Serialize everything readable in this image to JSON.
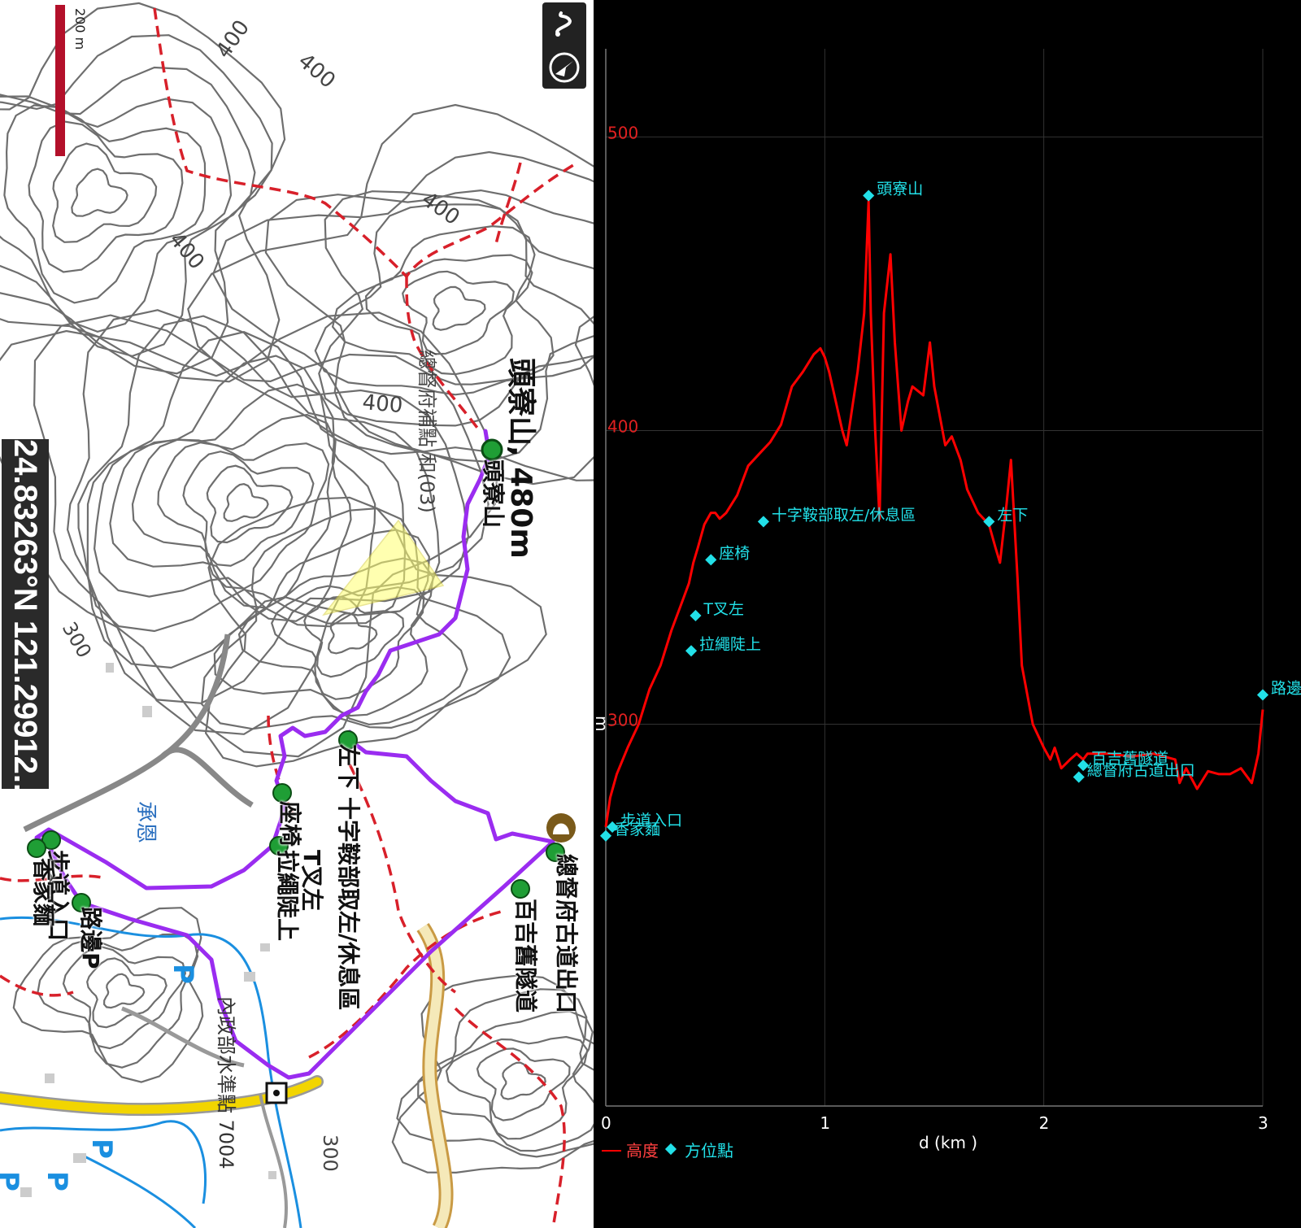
{
  "map": {
    "scale_label": "200 m",
    "coordinates": "24.83263°N 121.29912...",
    "summit_label": "頭寮山, 480m",
    "benchmark_label": "總督府補點 和(03)",
    "river_label": "承恩",
    "level_point_label": "內政部水準點 7004",
    "contour_labels": [
      "400",
      "400",
      "400",
      "400",
      "400",
      "300",
      "300"
    ],
    "waypoint_labels": [
      {
        "label": "頭寮山"
      },
      {
        "label": "左下"
      },
      {
        "label": "十字鞍部取左/休息區"
      },
      {
        "label": "座椅"
      },
      {
        "label": "T叉左"
      },
      {
        "label": "拉繩陡上"
      },
      {
        "label": "步道入口"
      },
      {
        "label": "香家麵"
      },
      {
        "label": "路邊P"
      },
      {
        "label": "總督府古道出口"
      },
      {
        "label": "百吉舊隧道"
      }
    ],
    "parking_labels": [
      "P",
      "P",
      "P",
      "P"
    ],
    "colors": {
      "track": "#9a2cf0",
      "trail": "#d8202a",
      "road": "#f2d500",
      "water": "#1a8fe0",
      "contour": "#555555"
    },
    "icons": {
      "scale": "scale-bar",
      "route": "route-icon",
      "compass": "compass-icon"
    }
  },
  "chart_data": {
    "type": "line",
    "title": "",
    "xlabel": "d (km )",
    "ylabel": "m",
    "xlim": [
      0,
      3.0
    ],
    "ylim": [
      170,
      530
    ],
    "x_ticks": [
      0,
      1,
      2,
      3
    ],
    "y_ticks": [
      300,
      400,
      500
    ],
    "grid": true,
    "legend_placement": "bottom-left",
    "series": [
      {
        "name": "高度",
        "color": "#ff0000",
        "x": [
          0.0,
          0.02,
          0.05,
          0.1,
          0.15,
          0.2,
          0.25,
          0.3,
          0.35,
          0.38,
          0.4,
          0.42,
          0.45,
          0.48,
          0.5,
          0.52,
          0.55,
          0.6,
          0.65,
          0.7,
          0.75,
          0.8,
          0.85,
          0.9,
          0.95,
          0.98,
          1.0,
          1.02,
          1.05,
          1.08,
          1.1,
          1.13,
          1.15,
          1.18,
          1.2,
          1.21,
          1.23,
          1.25,
          1.27,
          1.3,
          1.32,
          1.35,
          1.38,
          1.4,
          1.45,
          1.48,
          1.5,
          1.55,
          1.58,
          1.62,
          1.65,
          1.7,
          1.75,
          1.78,
          1.8,
          1.83,
          1.85,
          1.88,
          1.9,
          1.95,
          2.0,
          2.03,
          2.05,
          2.08,
          2.12,
          2.15,
          2.18,
          2.2,
          2.3,
          2.4,
          2.5,
          2.6,
          2.62,
          2.65,
          2.7,
          2.75,
          2.8,
          2.85,
          2.9,
          2.95,
          2.98,
          3.0
        ],
        "y": [
          265,
          275,
          283,
          292,
          300,
          312,
          320,
          332,
          342,
          348,
          355,
          360,
          368,
          372,
          372,
          370,
          372,
          378,
          388,
          392,
          396,
          402,
          415,
          420,
          426,
          428,
          425,
          420,
          410,
          400,
          395,
          410,
          420,
          440,
          478,
          440,
          400,
          370,
          440,
          460,
          430,
          400,
          410,
          415,
          412,
          430,
          415,
          395,
          398,
          390,
          380,
          372,
          368,
          360,
          355,
          375,
          390,
          350,
          320,
          300,
          292,
          288,
          292,
          285,
          288,
          290,
          288,
          290,
          290,
          289,
          290,
          288,
          280,
          285,
          278,
          284,
          283,
          283,
          285,
          280,
          290,
          305
        ]
      }
    ],
    "waypoints": {
      "name": "方位點",
      "color": "#22e0e8",
      "points": [
        {
          "x": 0.0,
          "y": 262,
          "label": "香家麵"
        },
        {
          "x": 0.03,
          "y": 265,
          "label": "步道入口"
        },
        {
          "x": 0.39,
          "y": 325,
          "label": "拉繩陡上"
        },
        {
          "x": 0.41,
          "y": 337,
          "label": "T叉左"
        },
        {
          "x": 0.48,
          "y": 356,
          "label": "座椅"
        },
        {
          "x": 0.72,
          "y": 369,
          "label": "十字鞍部取左/休息區"
        },
        {
          "x": 1.2,
          "y": 480,
          "label": "頭寮山"
        },
        {
          "x": 1.75,
          "y": 369,
          "label": "左下"
        },
        {
          "x": 2.18,
          "y": 286,
          "label": "百吉舊隧道"
        },
        {
          "x": 2.16,
          "y": 282,
          "label": "總督府古道出口"
        },
        {
          "x": 3.0,
          "y": 310,
          "label": "路邊P"
        }
      ]
    },
    "legend": [
      "高度",
      "方位點"
    ]
  }
}
